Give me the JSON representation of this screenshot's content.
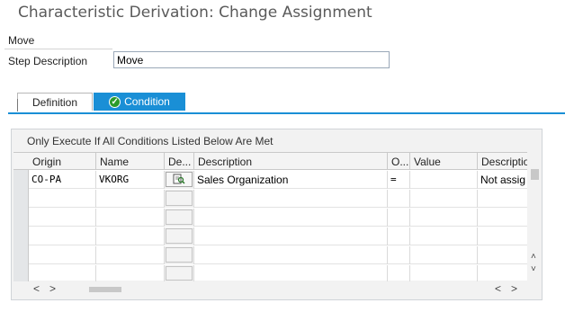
{
  "window": {
    "title": "Characteristic Derivation: Change Assignment"
  },
  "step": {
    "name": "Move",
    "description_label": "Step Description",
    "description_value": "Move"
  },
  "tabs": [
    {
      "label": "Definition",
      "active": false
    },
    {
      "label": "Condition",
      "active": true,
      "icon": "check-circle-icon"
    }
  ],
  "conditions": {
    "title": "Only Execute If All Conditions Listed Below Are Met",
    "columns": [
      "Origin",
      "Name",
      "De...",
      "Description",
      "O...",
      "Value",
      "Descriptio"
    ],
    "rows": [
      {
        "origin": "CO-PA",
        "name": "VKORG",
        "button_icon": "search-icon",
        "description": "Sales Organization",
        "operator": "=",
        "value": "",
        "value_description": "Not assig"
      }
    ],
    "empty_rows": 5
  },
  "colors": {
    "accent": "#1a8fd6",
    "check": "#2b9b2b"
  }
}
